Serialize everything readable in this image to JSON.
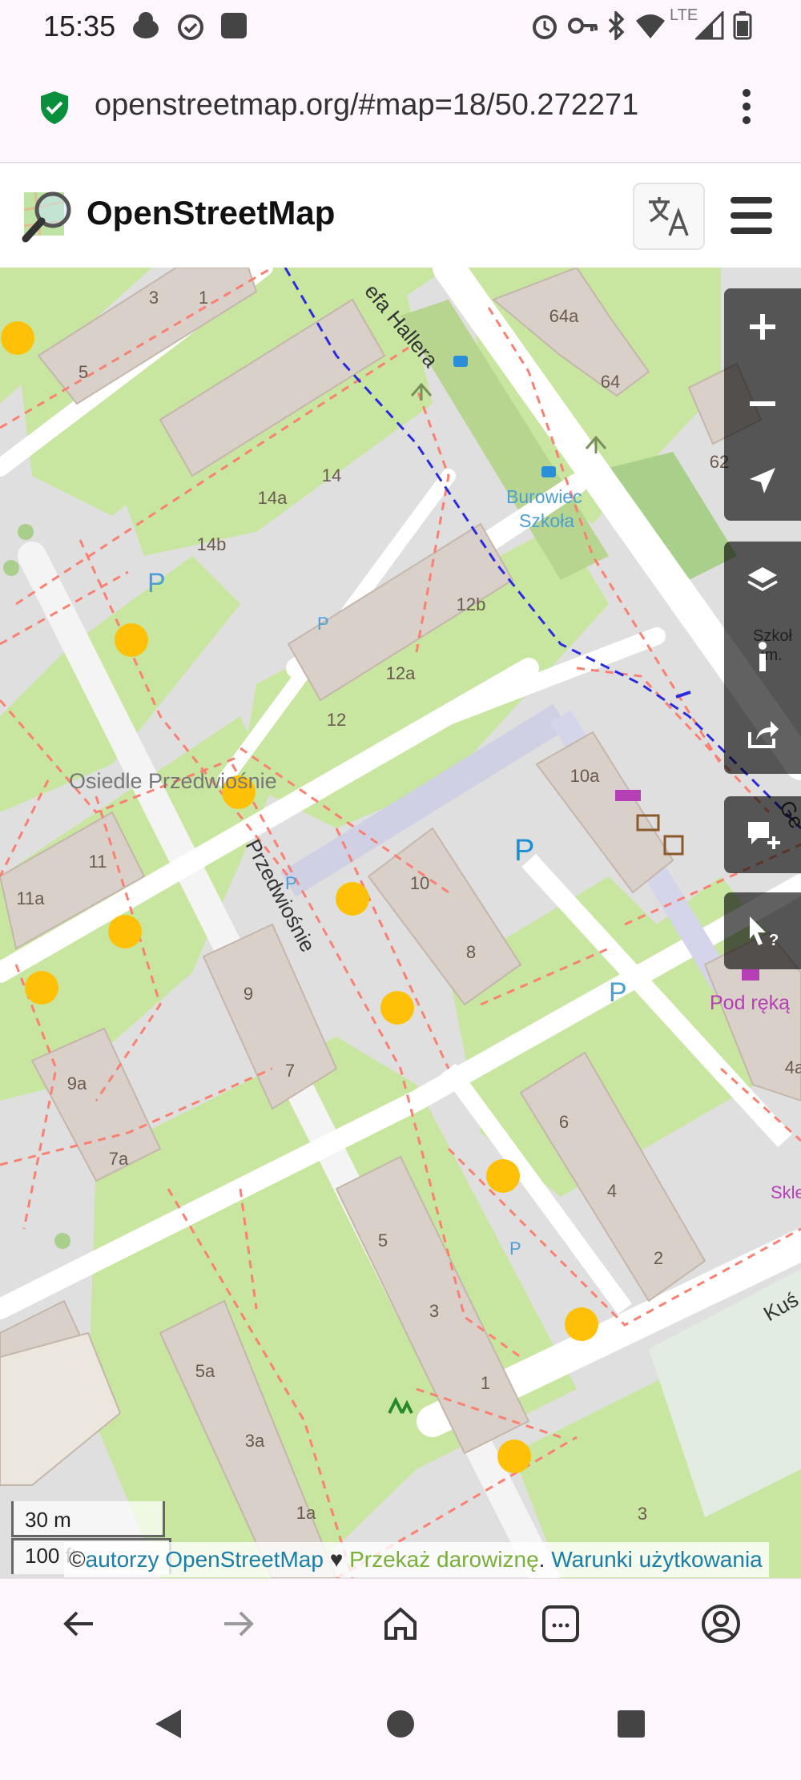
{
  "status_bar": {
    "time": "15:35",
    "network": "LTE",
    "left_icons": [
      "android-debug-icon",
      "alarm-check-icon",
      "square-app-icon"
    ],
    "right_icons": [
      "alarm-icon",
      "key-icon",
      "bluetooth-icon",
      "wifi-icon",
      "signal-icon",
      "battery-icon"
    ]
  },
  "browser": {
    "url": "openstreetmap.org/#map=18/50.272271",
    "security_icon": "shield-check-icon",
    "menu_icon": "kebab-menu-icon"
  },
  "osm_header": {
    "title": "OpenStreetMap",
    "logo_icon": "osm-magnifier-logo-icon",
    "language_icon": "translate-icon",
    "menu_icon": "hamburger-menu-icon"
  },
  "map": {
    "labels": {
      "street_top": "efa Hallera",
      "street_main": "Przedwiośnie",
      "area": "Osiedle Przedwiośnie",
      "bus_stop": "Burowiec\nSzkoła",
      "shop": "Pod ręką",
      "shop2": "Skle",
      "street_right": "Ge",
      "street_bottom": "Kuś",
      "school": "Szkoł\nim."
    },
    "house_numbers": [
      "1",
      "3",
      "5",
      "14",
      "14a",
      "14b",
      "12b",
      "12a",
      "12",
      "64a",
      "64",
      "62",
      "10a",
      "11",
      "11a",
      "10",
      "8",
      "9",
      "7",
      "9a",
      "7a",
      "6",
      "4",
      "2",
      "5",
      "3",
      "1",
      "5a",
      "3a",
      "1a",
      "3",
      "4a",
      "3"
    ],
    "parking_label": "P",
    "controls": [
      {
        "name": "zoom-in",
        "icon": "plus-icon"
      },
      {
        "name": "zoom-out",
        "icon": "minus-icon"
      },
      {
        "name": "locate",
        "icon": "location-arrow-icon"
      },
      {
        "name": "layers",
        "icon": "layers-icon"
      },
      {
        "name": "map-key",
        "icon": "info-icon"
      },
      {
        "name": "share",
        "icon": "share-icon"
      },
      {
        "name": "add-note",
        "icon": "comment-plus-icon"
      },
      {
        "name": "query-features",
        "icon": "cursor-question-icon"
      }
    ],
    "scale": {
      "metric": "30 m",
      "imperial": "100 ft"
    },
    "attribution": {
      "prefix": "©",
      "authors": "autorzy OpenStreetMap",
      "heart": "♥",
      "donate": "Przekaż darowiznę",
      "dot": ".",
      "terms": "Warunki użytkowania"
    }
  },
  "browser_nav": {
    "icons": [
      "back-arrow-icon",
      "forward-arrow-icon",
      "home-icon",
      "tabs-icon",
      "account-icon"
    ]
  },
  "system_nav": {
    "icons": [
      "back-triangle-icon",
      "home-circle-icon",
      "recents-square-icon"
    ]
  },
  "colors": {
    "grass": "#c8e6a0",
    "residential": "#e0dfdf",
    "building": "#d9d0c9",
    "building_border": "#c4b6ab",
    "footpath": "#fa8072",
    "road": "#ffffff",
    "marker": "#ffc107",
    "link": "#1a7fa8",
    "donate": "#7ab03a"
  }
}
